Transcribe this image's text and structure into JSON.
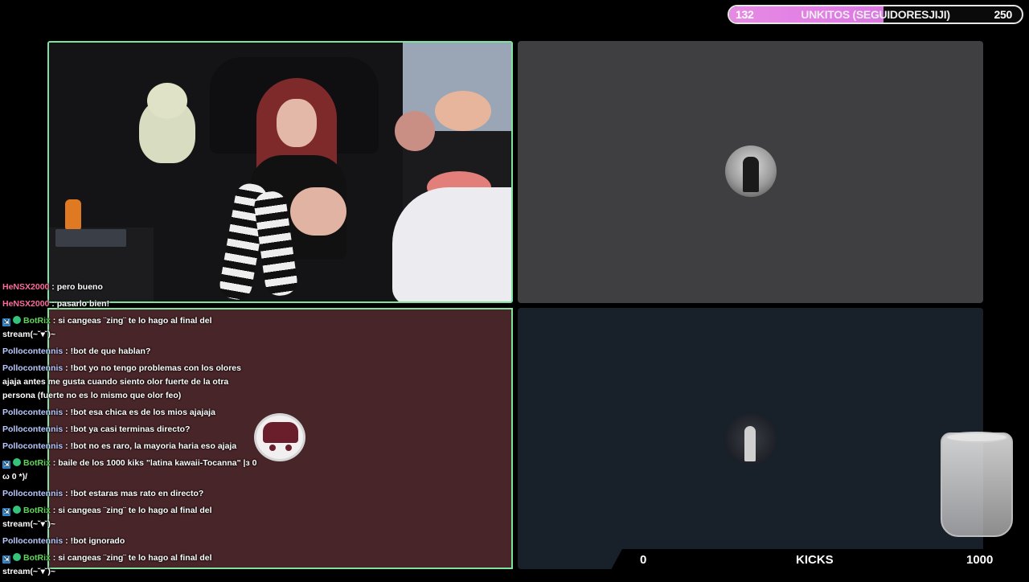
{
  "goal": {
    "current": "132",
    "title": "UNKITOS (SEGUIDORESJIJI)",
    "max": "250",
    "progress": 0.528,
    "fill_color": "#e27ee6"
  },
  "kicks": {
    "current": "0",
    "label": "KICKS",
    "max": "1000"
  },
  "colors": {
    "cam_border": "#7fe2a3",
    "chat_panel_bg": "#482528",
    "gray_panel_bg": "#3f3f41",
    "dark_panel_bg": "#18202a"
  },
  "chat": {
    "messages": [
      {
        "user": "HeNSX2000",
        "sep": " : ",
        "text": "pero bueno"
      },
      {
        "user": "HeNSX2000",
        "sep": " : ",
        "text": "pasarlo bien!"
      },
      {
        "user": "BotRix",
        "sep": " : ",
        "text": "si cangeas ¨zing¨ te lo hago al final del stream(~˘▾˘)~"
      },
      {
        "user": "Pollocontennis",
        "sep": " : ",
        "text": "!bot de que hablan?"
      },
      {
        "user": "Pollocontennis",
        "sep": " : ",
        "text": "!bot yo no tengo problemas con los olores ajaja antes me gusta cuando siento olor fuerte de la otra persona (fuerte no es lo mismo que olor feo)"
      },
      {
        "user": "Pollocontennis",
        "sep": " : ",
        "text": "!bot esa chica es de los mios ajajaja"
      },
      {
        "user": "Pollocontennis",
        "sep": " : ",
        "text": "!bot ya casi terminas directo?"
      },
      {
        "user": "Pollocontennis",
        "sep": " : ",
        "text": "!bot no es raro, la mayoria haria eso ajaja"
      },
      {
        "user": "BotRix",
        "sep": " : ",
        "text": "baile de los 1000 kiks \"latina kawaii-Tocanna\" |з 0 ω 0 *)/"
      },
      {
        "user": "Pollocontennis",
        "sep": " : ",
        "text": "!bot estaras mas rato en directo?"
      },
      {
        "user": "BotRix",
        "sep": " : ",
        "text": "si cangeas ¨zing¨ te lo hago al final del stream(~˘▾˘)~"
      },
      {
        "user": "Pollocontennis",
        "sep": " : ",
        "text": "!bot ignorado"
      },
      {
        "user": "BotRix",
        "sep": " : ",
        "text": "si cangeas ¨zing¨ te lo hago al final del stream(~˘▾˘)~"
      }
    ]
  }
}
